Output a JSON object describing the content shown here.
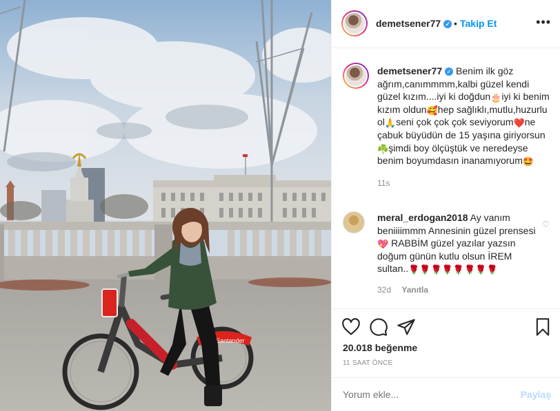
{
  "post": {
    "username": "demetsener77",
    "verified_mark": "✓",
    "separator": "•",
    "follow_label": "Takip Et",
    "more_label": "•••"
  },
  "caption": {
    "username": "demetsener77",
    "text_1": " Benim ilk göz ağrım,canımmmm,kalbi güzel kendi güzel kızım....iyi ki doğdun",
    "emoji_cake": "🎂",
    "text_2": "iyi ki benim kızım oldun",
    "emoji_smile": "🥰",
    "text_3": "hep sağlıklı,mutlu,huzurlu ol",
    "emoji_pray": "🙏",
    "text_4": "seni çok çok çok seviyorum",
    "emoji_heart": "❤️",
    "text_5": "ne çabuk büyüdün de 15 yaşına giriyorsun",
    "emoji_clover": "☘️",
    "text_6": "şimdi boy ölçüştük ve neredeyse benim boyumdasın inanamıyorum",
    "emoji_star": "🤩",
    "time": "11s"
  },
  "reply": {
    "username": "meral_erdogan2018",
    "text_1": " Ay vanım beniiiimmm Annesinin güzel prensesi",
    "emoji_heart": "💖",
    "text_2": " RABBİM güzel yazılar yazsın doğum günün kutlu olsun İREM sultan..",
    "emoji_roses": "🌹🌹🌹🌹🌹🌹🌹🌹",
    "time": "32d",
    "reply_label": "Yanıtla"
  },
  "actions": {
    "likes": "20.018 beğenme",
    "posted": "11 SAAT ÖNCE"
  },
  "add_comment": {
    "placeholder": "Yorum ekle...",
    "share_label": "Paylaş"
  },
  "photo": {
    "bike_brand": "Santander",
    "icons": [
      "lamp-post-sculpture",
      "victoria-memorial",
      "palace",
      "bicycle",
      "person"
    ]
  },
  "colors": {
    "link_blue": "#0095f6",
    "share_disabled": "#b3dbff",
    "muted": "#8e8e8e",
    "verified": "#3897f0",
    "bike_red": "#e2231a"
  }
}
